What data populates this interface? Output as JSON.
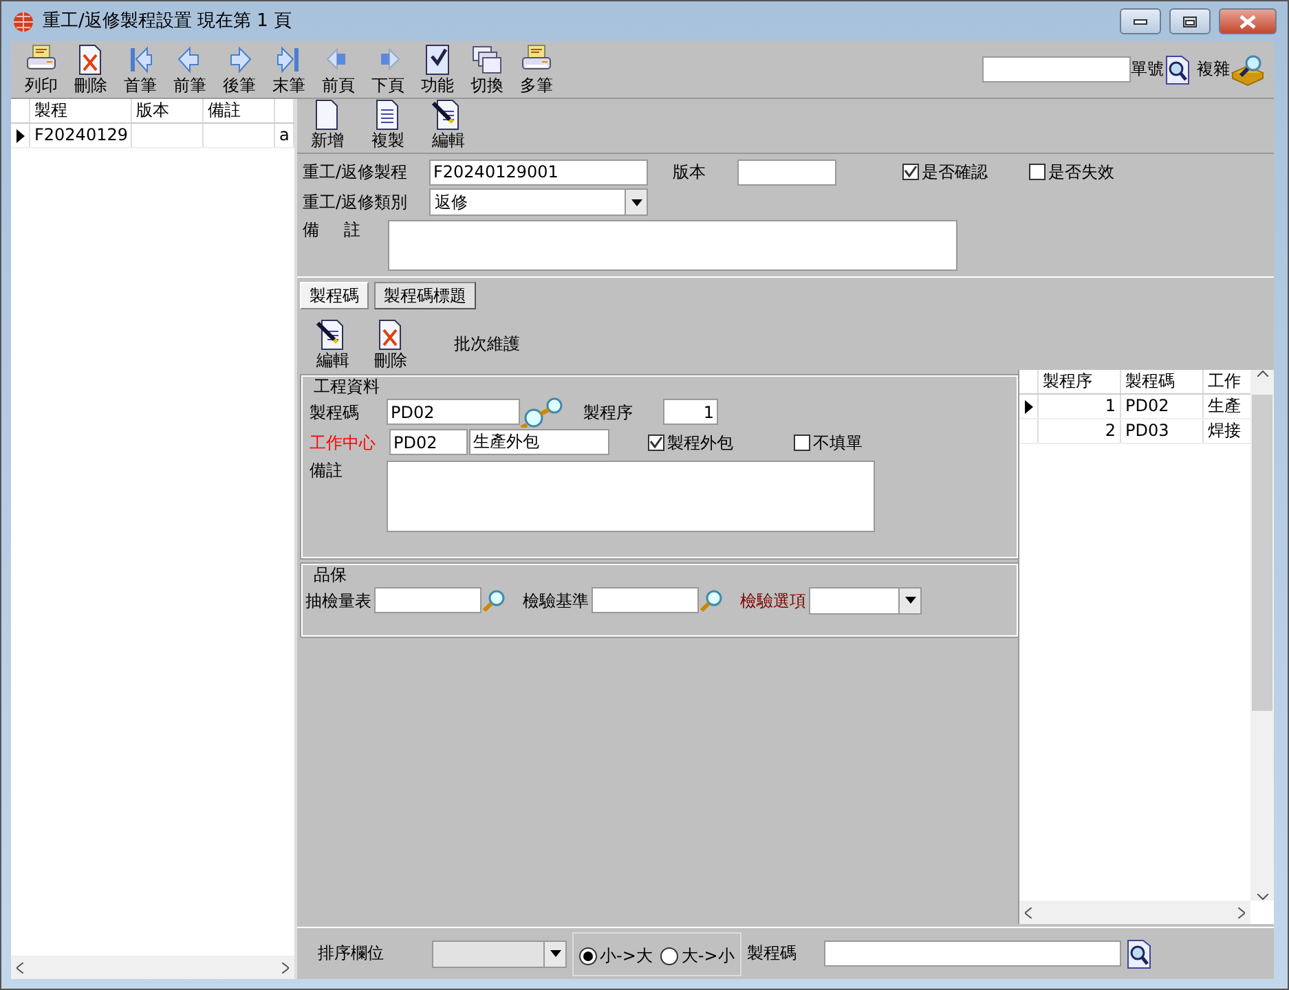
{
  "window": {
    "title": "重工/返修製程設置 現在第 1 頁"
  },
  "toolbar": {
    "buttons": [
      {
        "label": "列印"
      },
      {
        "label": "刪除"
      },
      {
        "label": "首筆"
      },
      {
        "label": "前筆"
      },
      {
        "label": "後筆"
      },
      {
        "label": "末筆"
      },
      {
        "label": "前頁"
      },
      {
        "label": "下頁"
      },
      {
        "label": "功能"
      },
      {
        "label": "切換"
      },
      {
        "label": "多筆"
      }
    ],
    "search_label": "單號",
    "complex_label": "複雜"
  },
  "list": {
    "columns": [
      "製程",
      "版本",
      "備註"
    ],
    "rows": [
      {
        "cells": [
          "F20240129",
          "",
          "",
          "a"
        ],
        "selected": true
      }
    ]
  },
  "record_toolbar": [
    {
      "label": "新增"
    },
    {
      "label": "複製"
    },
    {
      "label": "編輯"
    }
  ],
  "header_form": {
    "process_label": "重工/返修製程",
    "process_value": "F20240129001",
    "version_label": "版本",
    "checks": [
      {
        "label": "是否確認",
        "checked": true
      },
      {
        "label": "是否失效",
        "checked": false
      }
    ],
    "category_label": "重工/返修類別",
    "category_value": "返修",
    "note_label": "備 註"
  },
  "tabs": [
    {
      "label": "製程碼",
      "selected": true
    },
    {
      "label": "製程碼標題",
      "selected": false
    }
  ],
  "detail_toolbar": [
    {
      "label": "編輯"
    },
    {
      "label": "刪除"
    }
  ],
  "batch_label": "批次維護",
  "engineering": {
    "title": "工程資料",
    "fields": [
      {
        "label": "製程碼",
        "value": "PD02",
        "color": "#000000"
      },
      {
        "label": "製程序",
        "value": "1",
        "color": "#000000"
      },
      {
        "label": "工作中心",
        "value": "PD02",
        "color": "#ff0000"
      }
    ],
    "center_name": "生產外包",
    "checks": [
      {
        "label": "製程外包",
        "checked": true
      },
      {
        "label": "不填單",
        "checked": false
      }
    ],
    "note_label": "備註"
  },
  "quality": {
    "title": "品保",
    "fields": [
      {
        "label": "抽檢量表",
        "kind": "lookup",
        "color": "#000000"
      },
      {
        "label": "檢驗基準",
        "kind": "lookup",
        "color": "#000000"
      },
      {
        "label": "檢驗選項",
        "kind": "select",
        "color": "#800000"
      }
    ]
  },
  "steps_table": {
    "columns": [
      "製程序",
      "製程碼",
      "工作"
    ],
    "rows": [
      {
        "cells": [
          "1",
          "PD02",
          "生產"
        ],
        "selected": true
      },
      {
        "cells": [
          "2",
          "PD03",
          "焊接"
        ],
        "selected": false
      }
    ]
  },
  "sort_bar": {
    "label": "排序欄位",
    "options": [
      {
        "label": "小->大",
        "selected": true
      },
      {
        "label": "大->小",
        "selected": false
      }
    ],
    "search_label": "製程碼"
  }
}
